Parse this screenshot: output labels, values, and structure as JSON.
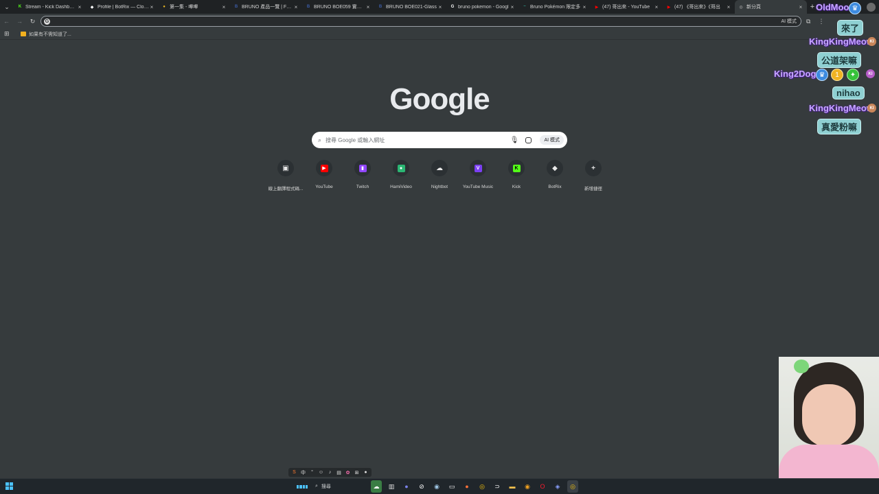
{
  "browser": {
    "tabs": [
      {
        "title": "Stream - Kick Dashboard",
        "favicon": "K",
        "color": "#53fc18",
        "active": false
      },
      {
        "title": "Profile | BotRix — Cloud",
        "favicon": "◆",
        "color": "#ffffff",
        "active": false
      },
      {
        "title": "第一集 - 嗶嗶",
        "favicon": "●",
        "color": "#e6b422",
        "active": false
      },
      {
        "title": "BRUNO 產品一覽 | Fortn",
        "favicon": "B",
        "color": "#3b5ba5",
        "active": false
      },
      {
        "title": "BRUNO BOE059 實石多",
        "favicon": "B",
        "color": "#3b5ba5",
        "active": false
      },
      {
        "title": "BRUNO BOE021-Glass",
        "favicon": "B",
        "color": "#3b5ba5",
        "active": false
      },
      {
        "title": "bruno pokemon - Googl",
        "favicon": "G",
        "color": "#ffffff",
        "active": false
      },
      {
        "title": "Bruno Pokémon 限定多",
        "favicon": "~",
        "color": "#2a9d8f",
        "active": false
      },
      {
        "title": "(47) 哥出來 - YouTube",
        "favicon": "▶",
        "color": "#ff0000",
        "active": false
      },
      {
        "title": "(47) 《哥出來》《哥出",
        "favicon": "▶",
        "color": "#ff0000",
        "active": false
      },
      {
        "title": "新分頁",
        "favicon": "◎",
        "color": "#bdbdbd",
        "active": true
      }
    ],
    "close_glyph": "×",
    "new_tab_glyph": "+",
    "omnibox": {
      "value": "",
      "ai_mode_label": "AI 模式"
    },
    "bookmarks": {
      "folder_label": "如果有不需知道了..."
    }
  },
  "google": {
    "logo_text": "Google",
    "search_placeholder": "搜尋 Google 或輸入網址",
    "ai_mode_label": "AI 模式",
    "shortcuts": [
      {
        "label": "線上翻譯程式碼...",
        "icon": "translate-icon",
        "color": "#e8e8e8",
        "glyph": "▣"
      },
      {
        "label": "YouTube",
        "icon": "youtube-icon",
        "color": "#ff0000",
        "glyph": "▶"
      },
      {
        "label": "Twitch",
        "icon": "twitch-icon",
        "color": "#9146ff",
        "glyph": "▮"
      },
      {
        "label": "HamiVideo",
        "icon": "hamivideo-icon",
        "color": "#2bb673",
        "glyph": "●"
      },
      {
        "label": "Nightbot",
        "icon": "nightbot-icon",
        "color": "#e8e8e8",
        "glyph": "☁"
      },
      {
        "label": "YouTube Music",
        "icon": "youtube-music-icon",
        "color": "#7b3ff2",
        "glyph": "V"
      },
      {
        "label": "Kick",
        "icon": "kick-icon",
        "color": "#53fc18",
        "glyph": "K"
      },
      {
        "label": "BotRix",
        "icon": "botrix-icon",
        "color": "#e8e8e8",
        "glyph": "◆"
      },
      {
        "label": "新增捷徑",
        "icon": "add-shortcut-icon",
        "color": "#e8e8e8",
        "glyph": "+"
      }
    ]
  },
  "chat": {
    "messages": [
      {
        "user": "OldMoo",
        "text": "來了"
      },
      {
        "user": "KingKingMeow",
        "text": "公道架嘛"
      },
      {
        "user": "King2Dog",
        "text": "nihao"
      },
      {
        "user": "KingKingMeow",
        "text": "真愛粉嘛"
      }
    ],
    "badge_label": "KI"
  },
  "taskbar": {
    "search_label": "搜尋"
  }
}
